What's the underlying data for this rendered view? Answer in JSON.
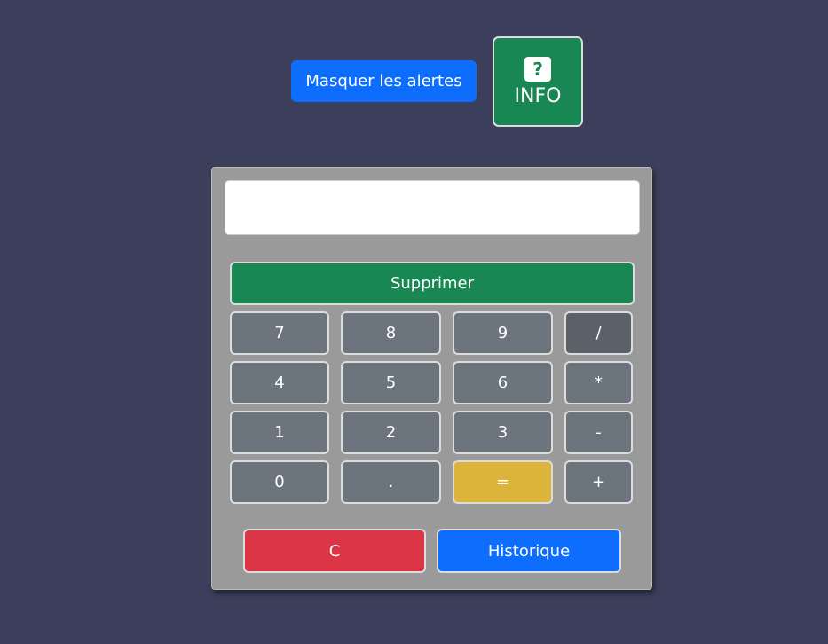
{
  "top": {
    "alerts_button_label": "Masquer les alertes",
    "info_icon": "?",
    "info_label": "INFO"
  },
  "calculator": {
    "display_value": "",
    "delete_label": "Supprimer",
    "keys": {
      "k7": "7",
      "k8": "8",
      "k9": "9",
      "div": "/",
      "k4": "4",
      "k5": "5",
      "k6": "6",
      "mul": "*",
      "k1": "1",
      "k2": "2",
      "k3": "3",
      "sub": "-",
      "k0": "0",
      "dot": ".",
      "eq": "=",
      "add": "+"
    },
    "clear_label": "C",
    "history_label": "Historique"
  },
  "colors": {
    "background": "#3c3f5b",
    "primary": "#0d6efd",
    "success": "#198754",
    "danger": "#dc3545",
    "warning": "#ddb43a",
    "key": "#6c757d"
  },
  "icons": {
    "info": "question-icon"
  }
}
